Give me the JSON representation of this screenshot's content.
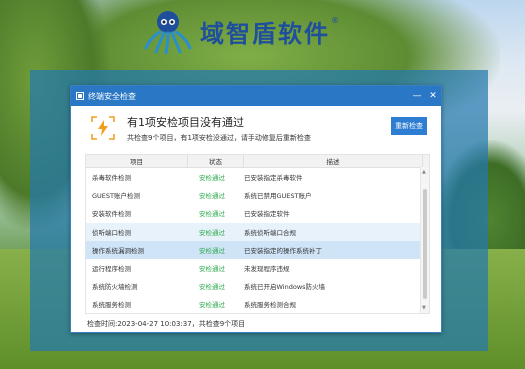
{
  "logo": {
    "text": "域智盾软件",
    "reg": "®"
  },
  "window": {
    "title": "终端安全检查",
    "controls": {
      "minimize": "—",
      "close": "✕"
    }
  },
  "summary": {
    "heading": "有1项安检项目没有通过",
    "sub": "共检查9个项目，有1项安检没通过，请手动修复后重新检查",
    "recheck_label": "重新检查"
  },
  "table": {
    "headers": [
      "项目",
      "状态",
      "描述"
    ],
    "rows": [
      {
        "item": "杀毒软件检测",
        "status": "安检通过",
        "desc": "已安装指定杀毒软件"
      },
      {
        "item": "GUEST账户检测",
        "status": "安检通过",
        "desc": "系统已禁用GUEST账户"
      },
      {
        "item": "安装软件检测",
        "status": "安检通过",
        "desc": "已安装指定软件"
      },
      {
        "item": "侦听端口检测",
        "status": "安检通过",
        "desc": "系统侦听端口合规"
      },
      {
        "item": "操作系统漏洞检测",
        "status": "安检通过",
        "desc": "已安装指定的操作系统补丁"
      },
      {
        "item": "运行程序检测",
        "status": "安检通过",
        "desc": "未发现程序违规"
      },
      {
        "item": "系统防火墙检测",
        "status": "安检通过",
        "desc": "系统已开启Windows防火墙"
      },
      {
        "item": "系统服务检测",
        "status": "安检通过",
        "desc": "系统服务检测合规"
      }
    ]
  },
  "footer": {
    "text": "检查时间:2023-04-27 10:03:37，共检查9个项目"
  },
  "colors": {
    "accent": "#2a78c5",
    "pass": "#2aa84a",
    "frame": "#2378af"
  }
}
